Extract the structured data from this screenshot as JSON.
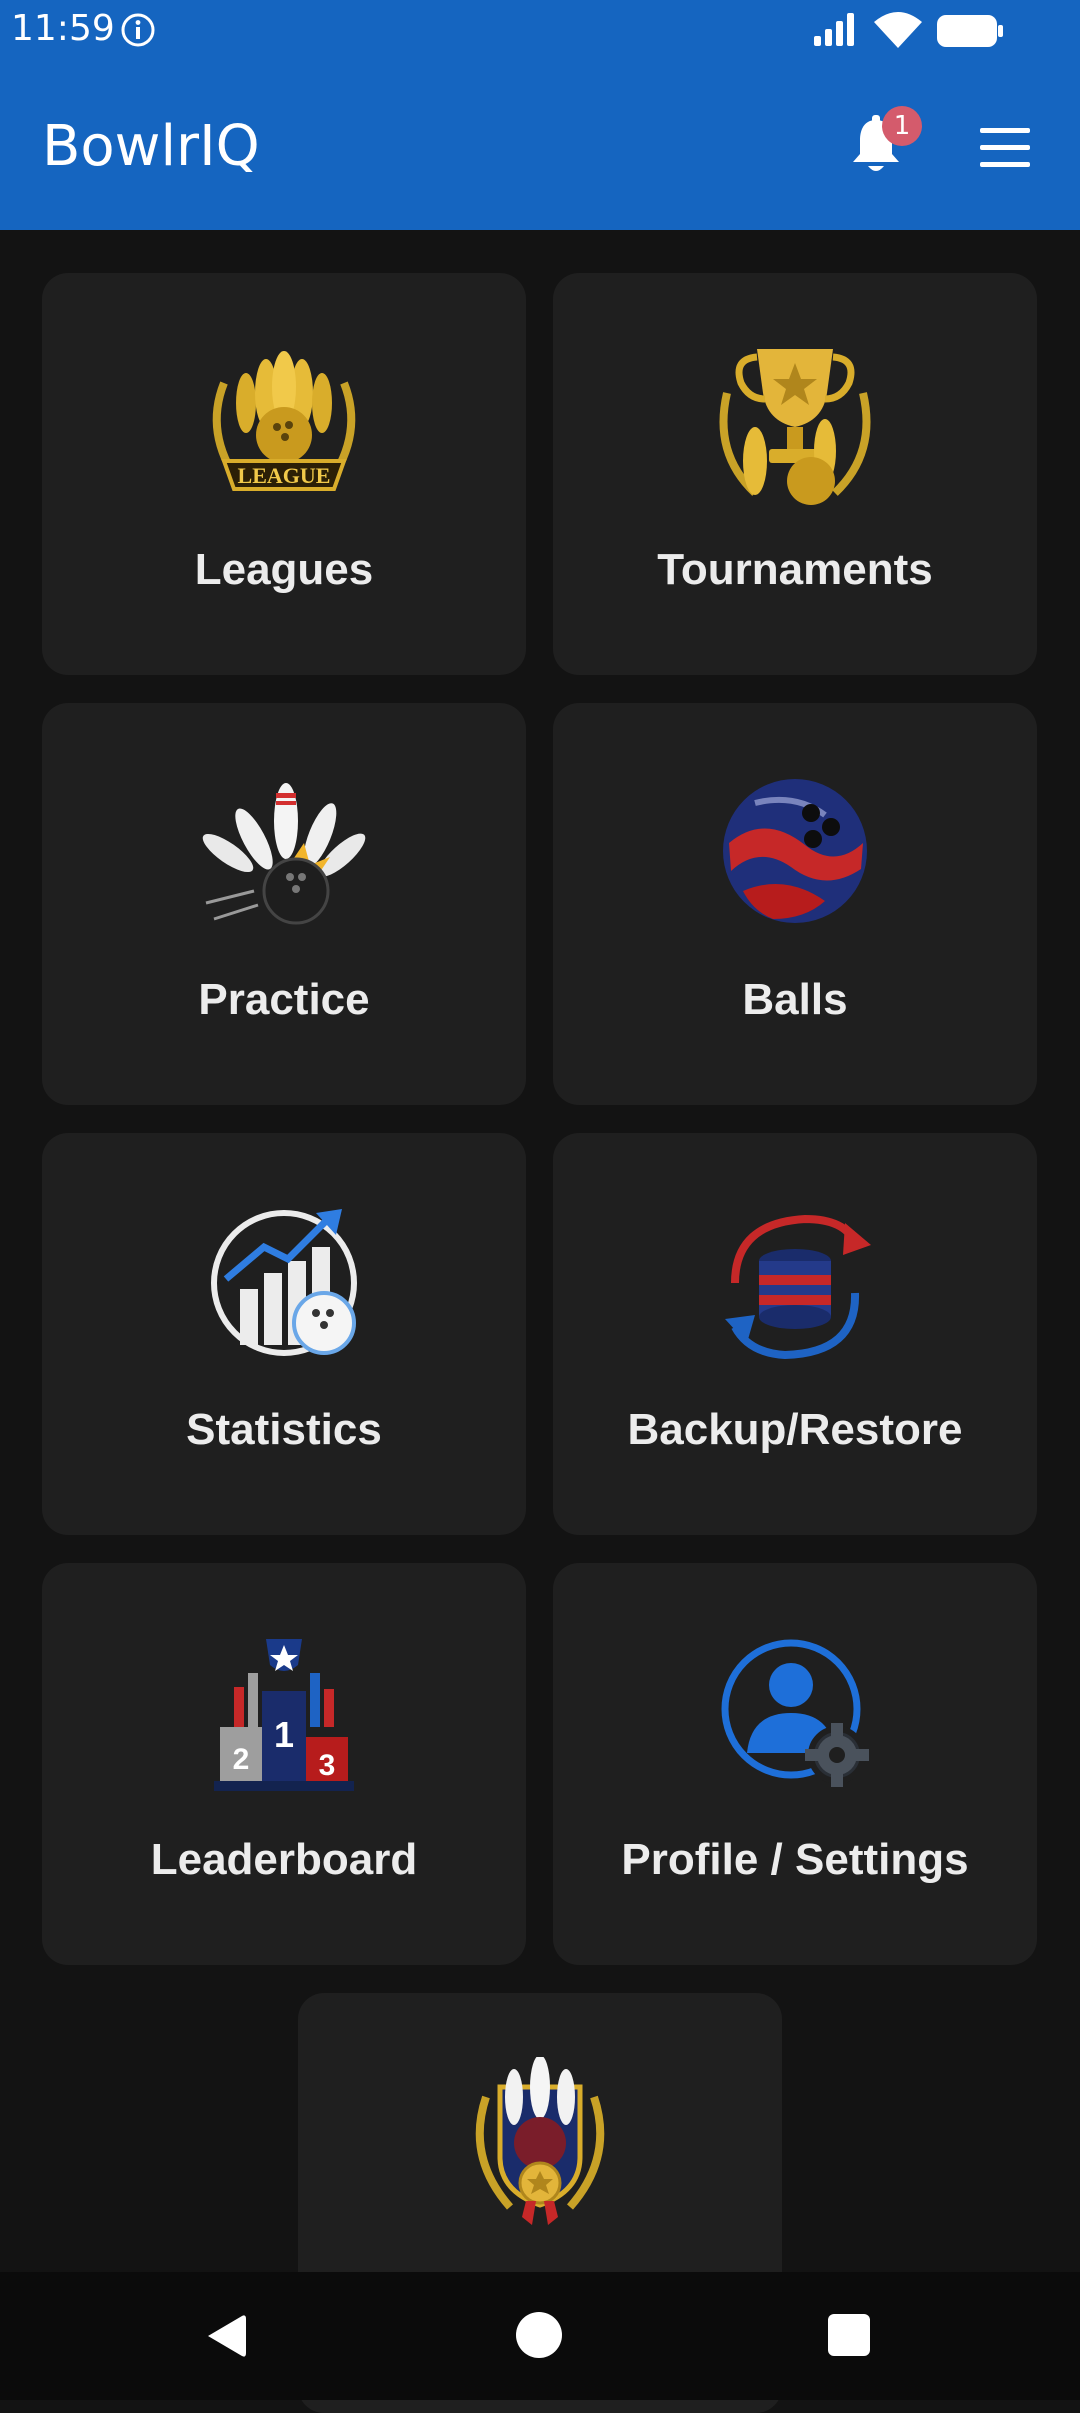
{
  "status_bar": {
    "time": "11:59"
  },
  "app_bar": {
    "title": "BowlrIQ",
    "notification_count": "1"
  },
  "tiles": [
    {
      "label": "Leagues",
      "icon": "league-crest-icon"
    },
    {
      "label": "Tournaments",
      "icon": "trophy-icon"
    },
    {
      "label": "Practice",
      "icon": "pins-strike-icon"
    },
    {
      "label": "Balls",
      "icon": "bowling-ball-icon"
    },
    {
      "label": "Statistics",
      "icon": "stats-chart-icon"
    },
    {
      "label": "Backup/Restore",
      "icon": "cloud-sync-icon"
    },
    {
      "label": "Leaderboard",
      "icon": "podium-icon"
    },
    {
      "label": "Profile / Settings",
      "icon": "profile-settings-icon"
    },
    {
      "label": "",
      "icon": "achievements-badge-icon"
    }
  ],
  "colors": {
    "app_bar": "#1565c0",
    "background": "#131313",
    "tile": "#1f1f1f",
    "badge": "#d45b6c"
  }
}
